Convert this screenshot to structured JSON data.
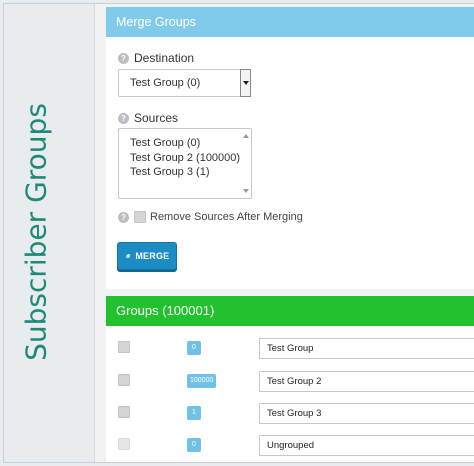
{
  "sidebar": {
    "title": "Subscriber Groups"
  },
  "merge_panel": {
    "header": "Merge Groups",
    "destination_label": "Destination",
    "destination_value": "Test Group (0)",
    "sources_label": "Sources",
    "sources": [
      "Test Group (0)",
      "Test Group 2 (100000)",
      "Test Group 3 (1)"
    ],
    "remove_label": "Remove Sources After Merging",
    "merge_button": "MERGE",
    "help_glyph": "?"
  },
  "groups_panel": {
    "header": "Groups (100001)",
    "rows": [
      {
        "count": "0",
        "name": "Test Group"
      },
      {
        "count": "100000",
        "name": "Test Group 2"
      },
      {
        "count": "1",
        "name": "Test Group 3"
      },
      {
        "count": "0",
        "name": "Ungrouped"
      }
    ]
  },
  "colors": {
    "accent_teal": "#1d8a77",
    "merge_header": "#7fcbe9",
    "groups_header": "#22c12e",
    "button_blue": "#1d8cc4",
    "badge_blue": "#6fc2e6"
  },
  "icons": {
    "help": "help-circle-icon",
    "merge": "link-icon"
  }
}
